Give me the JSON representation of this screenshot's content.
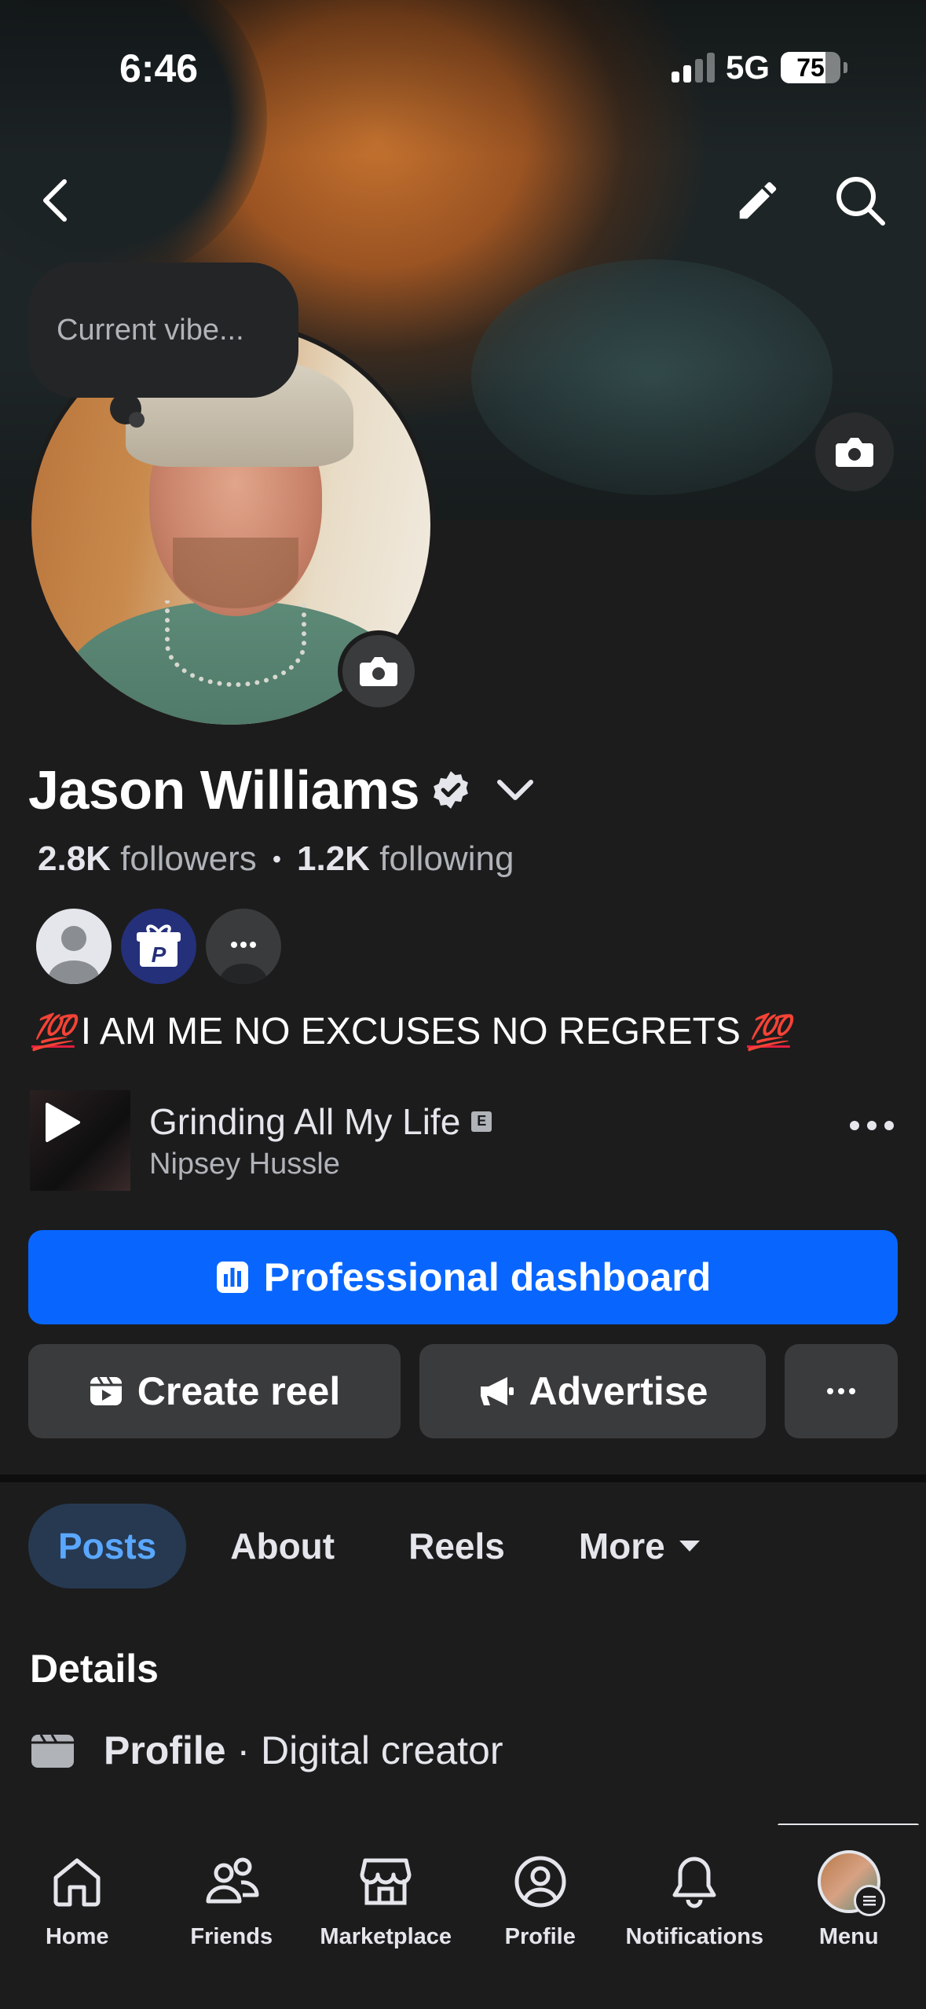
{
  "status_bar": {
    "time": "6:46",
    "network": "5G",
    "battery": "75",
    "battery_level": 0.75
  },
  "vibe": {
    "placeholder": "Current vibe..."
  },
  "profile": {
    "name": "Jason Williams",
    "followers_count": "2.8K",
    "followers_label": "followers",
    "following_count": "1.2K",
    "following_label": "following",
    "bio_emoji": "💯",
    "bio": "I AM ME NO EXCUSES NO REGRETS"
  },
  "music": {
    "song": "Grinding All My Life",
    "explicit": "E",
    "artist": "Nipsey Hussle"
  },
  "actions": {
    "professional_dashboard": "Professional dashboard",
    "create_reel": "Create reel",
    "advertise": "Advertise"
  },
  "tabs": [
    {
      "label": "Posts",
      "active": true
    },
    {
      "label": "About",
      "active": false
    },
    {
      "label": "Reels",
      "active": false
    },
    {
      "label": "More",
      "active": false
    }
  ],
  "details": {
    "title": "Details",
    "type": "Profile",
    "separator": " · ",
    "category": "Digital creator"
  },
  "bottom_nav": [
    {
      "label": "Home",
      "icon": "home-icon"
    },
    {
      "label": "Friends",
      "icon": "friends-icon"
    },
    {
      "label": "Marketplace",
      "icon": "marketplace-icon"
    },
    {
      "label": "Profile",
      "icon": "profile-icon"
    },
    {
      "label": "Notifications",
      "icon": "bell-icon"
    },
    {
      "label": "Menu",
      "icon": "menu-avatar"
    }
  ],
  "colors": {
    "accent": "#0866ff",
    "background": "#1c1c1d",
    "button": "#3a3b3c",
    "active_tab_bg": "#263951",
    "active_tab_text": "#5aa7ff"
  }
}
